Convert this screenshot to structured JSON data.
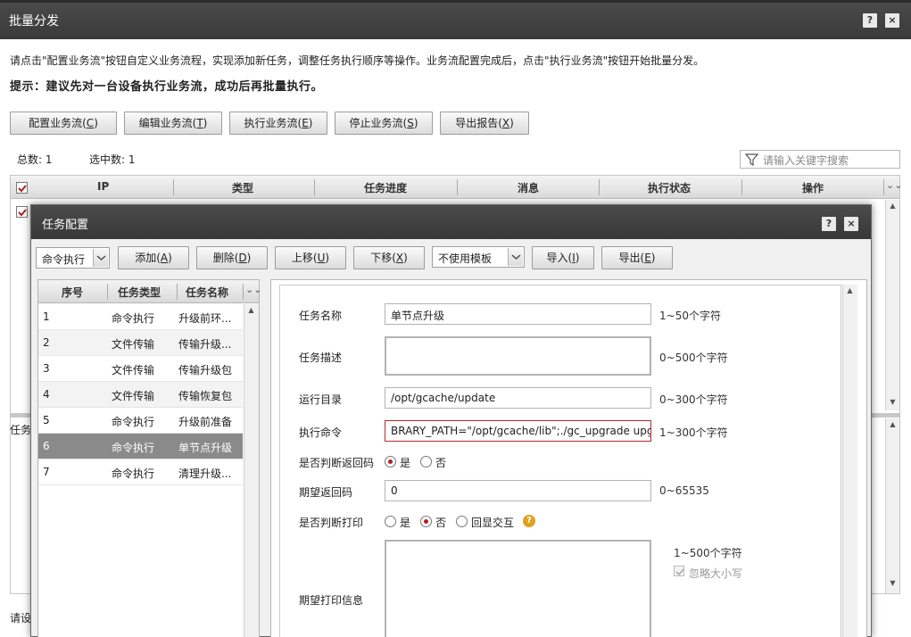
{
  "window": {
    "title": "批量分发",
    "help": "?",
    "close": "×"
  },
  "intro": {
    "line1": "请点击\"配置业务流\"按钮自定义业务流程，实现添加新任务，调整任务执行顺序等操作。业务流配置完成后，点击\"执行业务流\"按钮开始批量分发。",
    "line2": "提示：建议先对一台设备执行业务流，成功后再批量执行。"
  },
  "toolbar": [
    {
      "label": "配置业务流(",
      "key": "C"
    },
    {
      "label": "编辑业务流(",
      "key": "T"
    },
    {
      "label": "执行业务流(",
      "key": "E"
    },
    {
      "label": "停止业务流(",
      "key": "S"
    },
    {
      "label": "导出报告(",
      "key": "X"
    }
  ],
  "stats": {
    "total": "总数:  1",
    "selected": "选中数:  1"
  },
  "search": {
    "placeholder": "请输入关键字搜索"
  },
  "grid": {
    "columns": [
      "IP",
      "类型",
      "任务进度",
      "消息",
      "执行状态",
      "操作"
    ]
  },
  "bottom": {
    "label1": "任务",
    "label2": "请设"
  },
  "dialog": {
    "title": "任务配置",
    "help": "?",
    "close": "×",
    "type_select": "命令执行",
    "buttons": [
      {
        "label": "添加(",
        "key": "A"
      },
      {
        "label": "删除(",
        "key": "D"
      },
      {
        "label": "上移(",
        "key": "U"
      },
      {
        "label": "下移(",
        "key": "X"
      }
    ],
    "template_select": "不使用模板",
    "import": {
      "label": "导入(",
      "key": "I"
    },
    "export": {
      "label": "导出(",
      "key": "E"
    },
    "list": {
      "columns": [
        "序号",
        "任务类型",
        "任务名称"
      ],
      "rows": [
        {
          "no": "1",
          "type": "命令执行",
          "name": "升级前环..."
        },
        {
          "no": "2",
          "type": "文件传输",
          "name": "传输升级..."
        },
        {
          "no": "3",
          "type": "文件传输",
          "name": "传输升级包"
        },
        {
          "no": "4",
          "type": "文件传输",
          "name": "传输恢复包"
        },
        {
          "no": "5",
          "type": "命令执行",
          "name": "升级前准备"
        },
        {
          "no": "6",
          "type": "命令执行",
          "name": "单节点升级"
        },
        {
          "no": "7",
          "type": "命令执行",
          "name": "清理升级..."
        }
      ],
      "selected_index": 5
    },
    "form": {
      "task_name": {
        "label": "任务名称",
        "value": "单节点升级",
        "hint": "1~50个字符"
      },
      "task_desc": {
        "label": "任务描述",
        "value": "",
        "hint": "0~500个字符"
      },
      "run_dir": {
        "label": "运行目录",
        "value": "/opt/gcache/update",
        "hint": "0~300个字符"
      },
      "command": {
        "label": "执行命令",
        "value": "BRARY_PATH=\"/opt/gcache/lib\";./gc_upgrade upgrade",
        "hint": "1~300个字符"
      },
      "check_code": {
        "label": "是否判断返回码",
        "yes": "是",
        "no": "否",
        "selected": "yes"
      },
      "expect_code": {
        "label": "期望返回码",
        "value": "0",
        "hint": "0~65535"
      },
      "check_print": {
        "label": "是否判断打印",
        "yes": "是",
        "no": "否",
        "echo": "回显交互",
        "selected": "no"
      },
      "expect_print": {
        "label": "期望打印信息",
        "value": "",
        "hint": "1~500个字符",
        "ignore_case": "忽略大小写"
      }
    }
  }
}
